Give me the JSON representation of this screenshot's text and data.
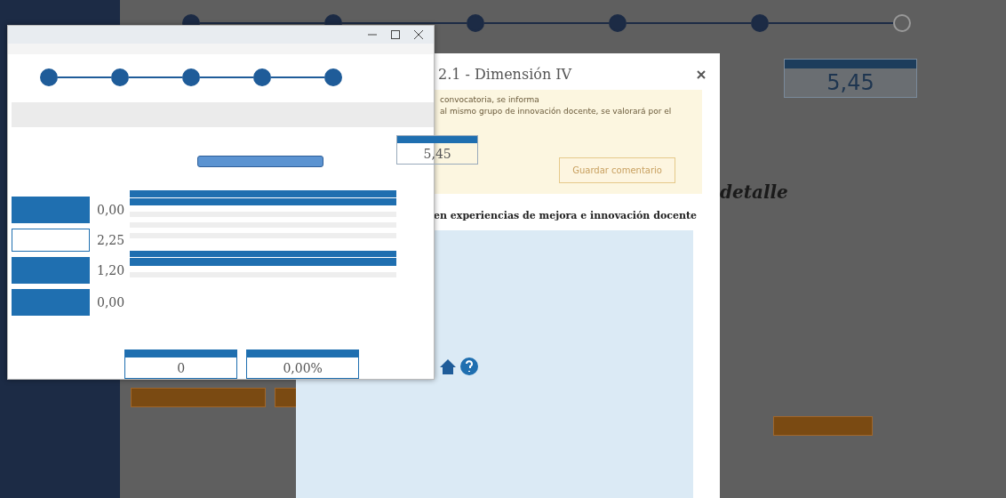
{
  "background": {
    "steps": [
      {
        "done": true
      },
      {
        "done": true
      },
      {
        "done": true
      },
      {
        "done": true
      },
      {
        "done": true
      },
      {
        "done": false
      }
    ],
    "total": "5,45",
    "heading": "detalle"
  },
  "modal": {
    "title": "2.1 - Dimensión IV",
    "notice": [
      "convocatoria, se informa",
      "al mismo grupo de innovación docente, se valorará por el"
    ],
    "save_button": "Guardar comentario",
    "section_title": "en experiencias de mejora e innovación docente"
  },
  "popup": {
    "steps": [
      {
        "done": true
      },
      {
        "done": true
      },
      {
        "done": true
      },
      {
        "done": true
      },
      {
        "done": true
      }
    ],
    "total": "5,45",
    "scores": [
      "0,00",
      "2,25",
      "1,20",
      "0,00"
    ],
    "summary": [
      "0",
      "0,00%"
    ]
  }
}
